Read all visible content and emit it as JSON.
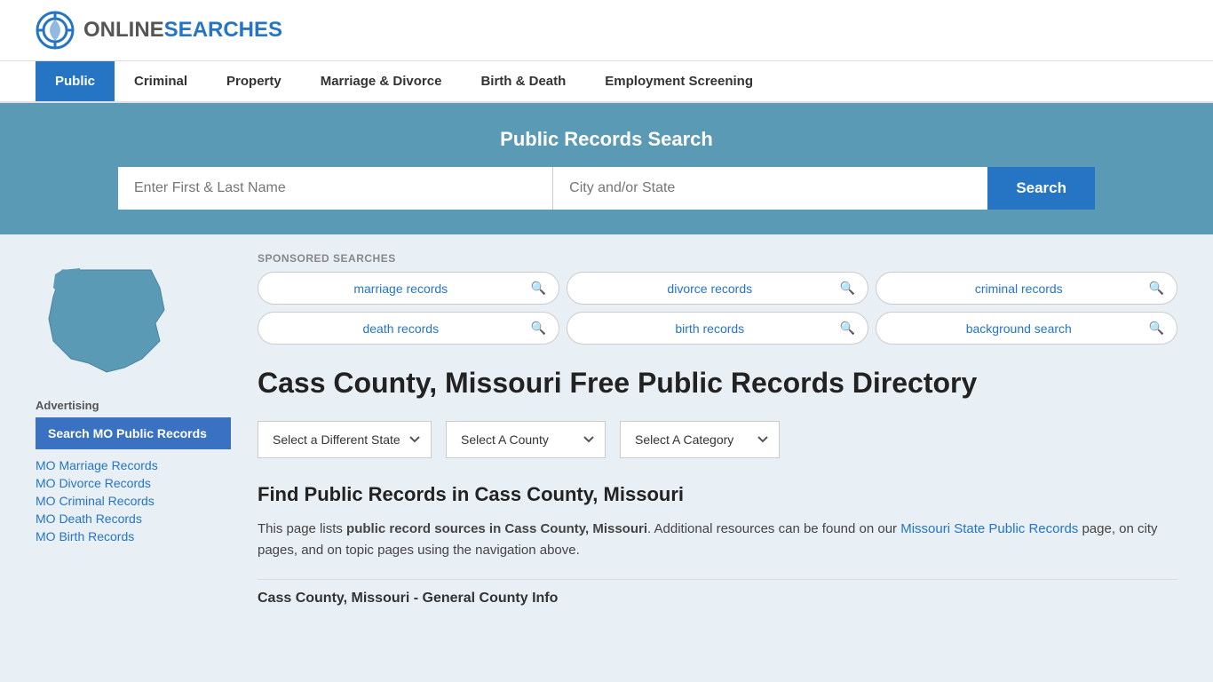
{
  "header": {
    "logo_online": "ONLINE",
    "logo_searches": "SEARCHES"
  },
  "nav": {
    "items": [
      {
        "label": "Public",
        "active": true
      },
      {
        "label": "Criminal",
        "active": false
      },
      {
        "label": "Property",
        "active": false
      },
      {
        "label": "Marriage & Divorce",
        "active": false
      },
      {
        "label": "Birth & Death",
        "active": false
      },
      {
        "label": "Employment Screening",
        "active": false
      }
    ]
  },
  "search_banner": {
    "title": "Public Records Search",
    "name_placeholder": "Enter First & Last Name",
    "location_placeholder": "City and/or State",
    "search_label": "Search"
  },
  "sponsored": {
    "label": "SPONSORED SEARCHES",
    "items": [
      {
        "text": "marriage records"
      },
      {
        "text": "divorce records"
      },
      {
        "text": "criminal records"
      },
      {
        "text": "death records"
      },
      {
        "text": "birth records"
      },
      {
        "text": "background search"
      }
    ]
  },
  "page_heading": "Cass County, Missouri Free Public Records Directory",
  "dropdowns": {
    "state_label": "Select a Different State",
    "county_label": "Select A County",
    "category_label": "Select A Category"
  },
  "find_section": {
    "heading": "Find Public Records in Cass County, Missouri",
    "paragraph_start": "This page lists ",
    "bold_text": "public record sources in Cass County, Missouri",
    "paragraph_mid": ". Additional resources can be found on our ",
    "link_text": "Missouri State Public Records",
    "paragraph_end": " page, on city pages, and on topic pages using the navigation above."
  },
  "general_info_title": "Cass County, Missouri - General County Info",
  "sidebar": {
    "ad_label": "Advertising",
    "ad_box_text": "Search MO Public Records",
    "links": [
      "MO Marriage Records",
      "MO Divorce Records",
      "MO Criminal Records",
      "MO Death Records",
      "MO Birth Records"
    ]
  }
}
